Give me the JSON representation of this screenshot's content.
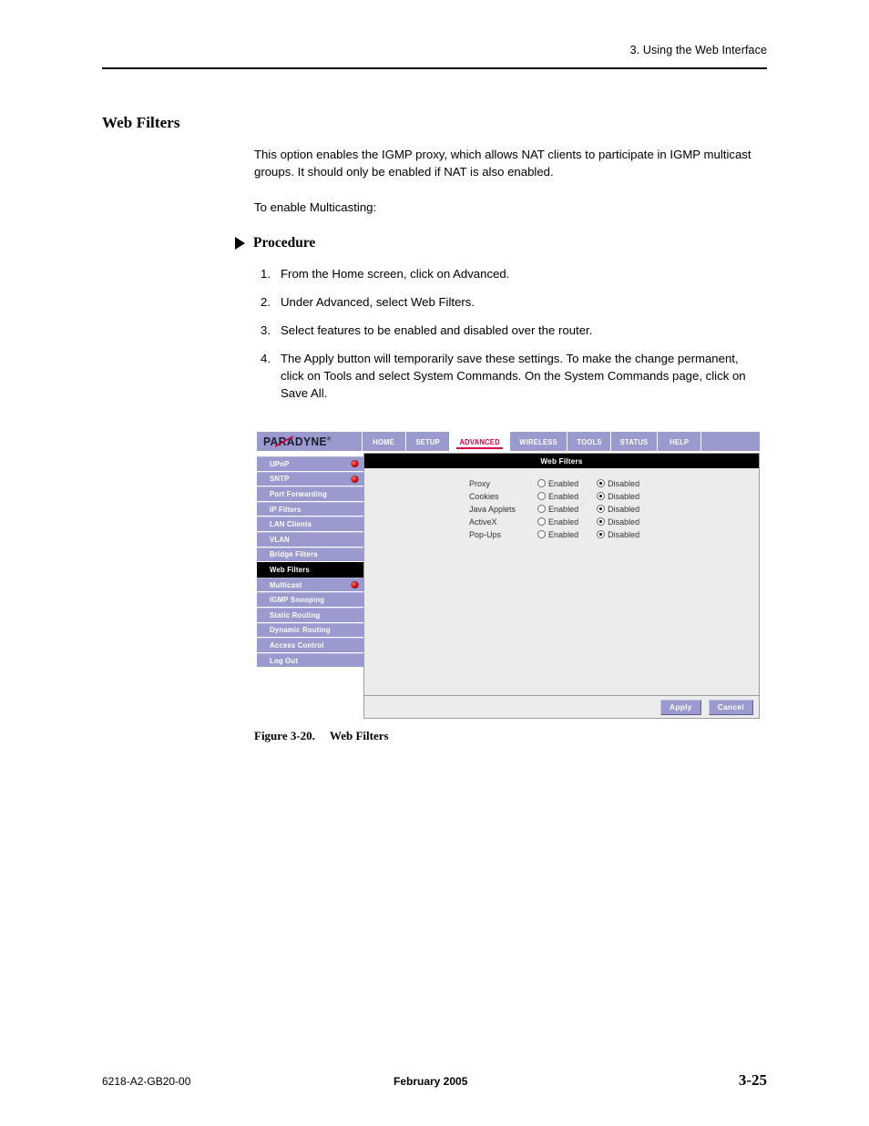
{
  "page": {
    "running_head": "3. Using the Web Interface",
    "section_title": "Web Filters",
    "paragraphs": [
      "This option enables the IGMP proxy, which allows NAT clients to participate in IGMP multicast groups. It should only be enabled if NAT is also enabled.",
      "To enable Multicasting:"
    ],
    "procedure_heading": "Procedure",
    "steps": [
      {
        "num": "1.",
        "text": "From the Home screen, click on Advanced."
      },
      {
        "num": "2.",
        "text": "Under Advanced, select Web Filters."
      },
      {
        "num": "3.",
        "text": "Select features to be enabled and disabled over the router."
      },
      {
        "num": "4.",
        "text": "The Apply button will temporarily save these settings. To make the change permanent, click on Tools and select System Commands. On the System Commands page, click on Save All."
      }
    ],
    "figure": {
      "label": "Figure 3-20.",
      "title": "Web Filters"
    },
    "footer": {
      "doc_number": "6218-A2-GB20-00",
      "date": "February 2005",
      "page_number": "3-25"
    }
  },
  "screenshot": {
    "brand": {
      "name": "PARADYNE",
      "trademark": "®",
      "slash_color": "#d6004a"
    },
    "nav_tabs": [
      {
        "label": "HOME",
        "active": false
      },
      {
        "label": "SETUP",
        "active": false
      },
      {
        "label": "ADVANCED",
        "active": true
      },
      {
        "label": "WIRELESS",
        "active": false
      },
      {
        "label": "TOOLS",
        "active": false
      },
      {
        "label": "STATUS",
        "active": false
      },
      {
        "label": "HELP",
        "active": false
      }
    ],
    "sidebar": [
      {
        "label": "UPnP",
        "selected": false,
        "dot": true
      },
      {
        "label": "SNTP",
        "selected": false,
        "dot": true
      },
      {
        "label": "Port Forwarding",
        "selected": false,
        "dot": false
      },
      {
        "label": "IP Filters",
        "selected": false,
        "dot": false
      },
      {
        "label": "LAN Clients",
        "selected": false,
        "dot": false
      },
      {
        "label": "VLAN",
        "selected": false,
        "dot": false
      },
      {
        "label": "Bridge Filters",
        "selected": false,
        "dot": false
      },
      {
        "label": "Web Filters",
        "selected": true,
        "dot": false
      },
      {
        "label": "Multicast",
        "selected": false,
        "dot": true
      },
      {
        "label": "IGMP Snooping",
        "selected": false,
        "dot": false
      },
      {
        "label": "Static Routing",
        "selected": false,
        "dot": false
      },
      {
        "label": "Dynamic Routing",
        "selected": false,
        "dot": false
      },
      {
        "label": "Access Control",
        "selected": false,
        "dot": false
      },
      {
        "label": "Log Out",
        "selected": false,
        "dot": false
      }
    ],
    "panel_title": "Web Filters",
    "option_labels": {
      "enabled": "Enabled",
      "disabled": "Disabled"
    },
    "filters": [
      {
        "name": "Proxy",
        "value": "Disabled"
      },
      {
        "name": "Cookies",
        "value": "Disabled"
      },
      {
        "name": "Java Applets",
        "value": "Disabled"
      },
      {
        "name": "ActiveX",
        "value": "Disabled"
      },
      {
        "name": "Pop-Ups",
        "value": "Disabled"
      }
    ],
    "buttons": {
      "apply": "Apply",
      "cancel": "Cancel"
    },
    "colors": {
      "chrome": "#9a9ace",
      "accent_red": "#d6004a",
      "panel_bg": "#ececec",
      "selected_bg": "#000000"
    }
  }
}
